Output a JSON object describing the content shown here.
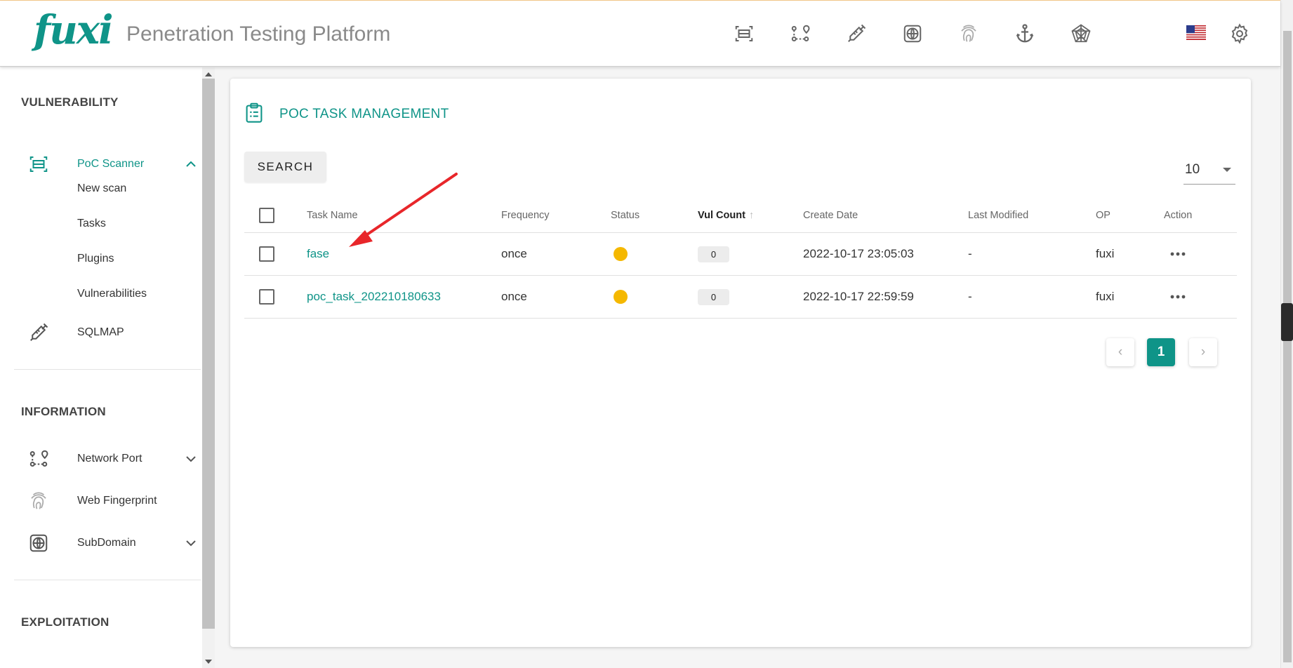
{
  "header": {
    "logo": "fuxi",
    "title": "Penetration Testing Platform",
    "icons": [
      "scanner-icon",
      "network-port-icon",
      "syringe-icon",
      "subdomain-icon",
      "fingerprint-icon",
      "anchor-icon",
      "spider-web-icon",
      "us-flag-icon",
      "gear-icon"
    ]
  },
  "sidebar": {
    "sections": [
      {
        "title": "VULNERABILITY",
        "items": [
          {
            "label": "PoC Scanner",
            "icon": "scanner-icon",
            "expanded": true,
            "active": true,
            "children": [
              "New scan",
              "Tasks",
              "Plugins",
              "Vulnerabilities"
            ],
            "active_child": "Tasks"
          },
          {
            "label": "SQLMAP",
            "icon": "syringe-icon"
          }
        ]
      },
      {
        "title": "INFORMATION",
        "items": [
          {
            "label": "Network Port",
            "icon": "network-port-icon",
            "expandable": true
          },
          {
            "label": "Web Fingerprint",
            "icon": "fingerprint-icon"
          },
          {
            "label": "SubDomain",
            "icon": "subdomain-icon",
            "expandable": true
          }
        ]
      },
      {
        "title": "EXPLOITATION",
        "items": []
      }
    ]
  },
  "main": {
    "title": "POC TASK MANAGEMENT",
    "search_label": "SEARCH",
    "per_page": "10",
    "columns": [
      "Task Name",
      "Frequency",
      "Status",
      "Vul Count",
      "Create Date",
      "Last Modified",
      "OP",
      "Action"
    ],
    "sorted_column": "Vul Count",
    "rows": [
      {
        "task_name": "fase",
        "frequency": "once",
        "status": "pending",
        "vul_count": "0",
        "create_date": "2022-10-17 23:05:03",
        "last_modified": "-",
        "op": "fuxi"
      },
      {
        "task_name": "poc_task_202210180633",
        "frequency": "once",
        "status": "pending",
        "vul_count": "0",
        "create_date": "2022-10-17 22:59:59",
        "last_modified": "-",
        "op": "fuxi"
      }
    ],
    "pagination": {
      "current": "1"
    }
  },
  "colors": {
    "accent": "#0f9488",
    "status_pending": "#f5b800",
    "annotation": "#e8262a"
  }
}
